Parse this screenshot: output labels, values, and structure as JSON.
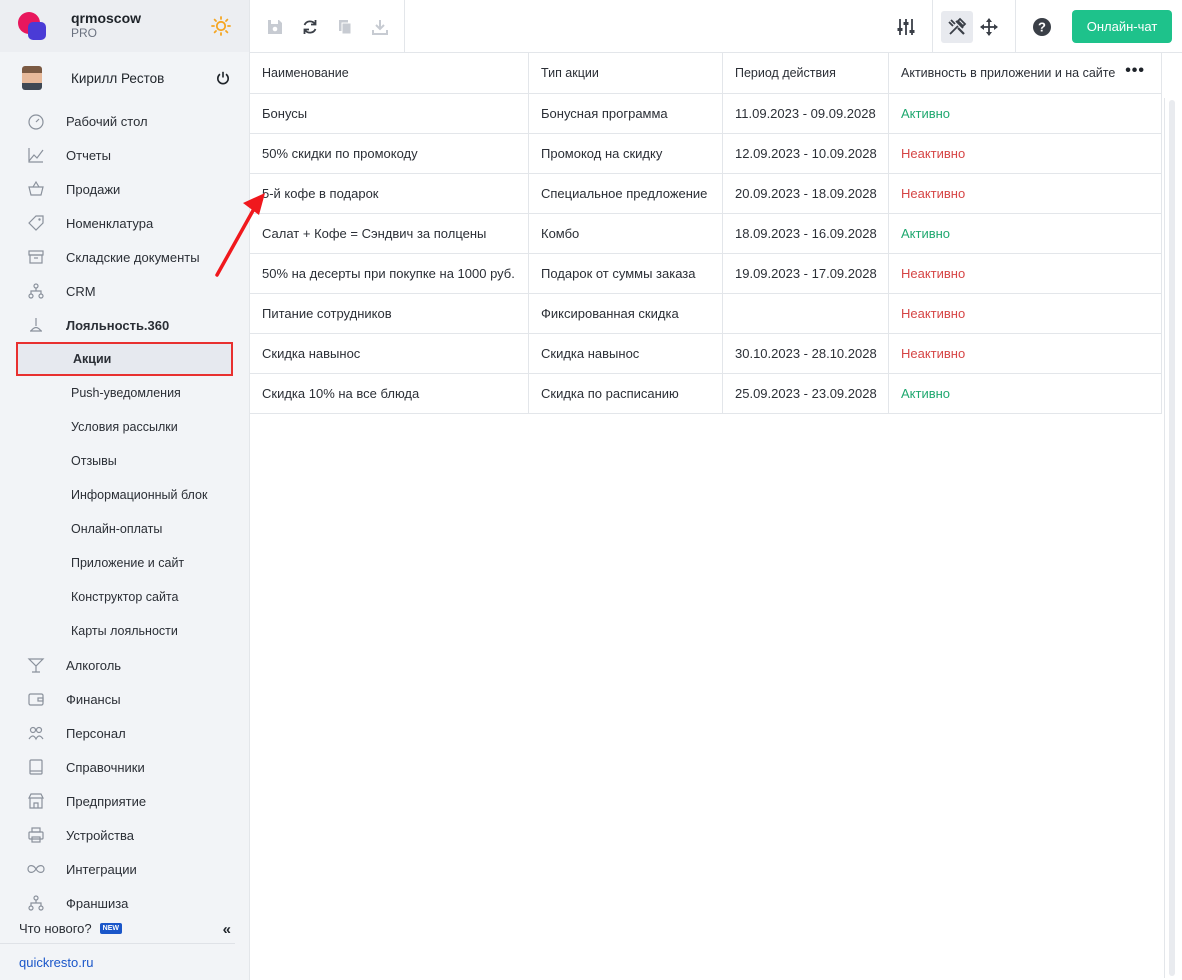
{
  "brand": {
    "name": "qrmoscow",
    "plan": "PRO"
  },
  "user": {
    "name": "Кирилл Рестов"
  },
  "nav": {
    "items": [
      {
        "label": "Рабочий стол",
        "icon": "dashboard-icon"
      },
      {
        "label": "Отчеты",
        "icon": "chart-icon"
      },
      {
        "label": "Продажи",
        "icon": "basket-icon"
      },
      {
        "label": "Номенклатура",
        "icon": "tag-icon"
      },
      {
        "label": "Складские документы",
        "icon": "archive-icon"
      },
      {
        "label": "CRM",
        "icon": "hierarchy-icon"
      },
      {
        "label": "Лояльность.360",
        "icon": "loyalty-icon"
      }
    ],
    "sub": [
      {
        "label": "Акции"
      },
      {
        "label": "Push-уведомления"
      },
      {
        "label": "Условия рассылки"
      },
      {
        "label": "Отзывы"
      },
      {
        "label": "Информационный блок"
      },
      {
        "label": "Онлайн-оплаты"
      },
      {
        "label": "Приложение и сайт"
      },
      {
        "label": "Конструктор сайта"
      },
      {
        "label": "Карты лояльности"
      }
    ],
    "items2": [
      {
        "label": "Алкоголь",
        "icon": "cocktail-icon"
      },
      {
        "label": "Финансы",
        "icon": "wallet-icon"
      },
      {
        "label": "Персонал",
        "icon": "people-icon"
      },
      {
        "label": "Справочники",
        "icon": "book-icon"
      },
      {
        "label": "Предприятие",
        "icon": "store-icon"
      },
      {
        "label": "Устройства",
        "icon": "printer-icon"
      },
      {
        "label": "Интеграции",
        "icon": "infinity-icon"
      },
      {
        "label": "Франшиза",
        "icon": "hierarchy-icon"
      }
    ]
  },
  "footer": {
    "whatsnew": "Что нового?",
    "badge": "NEW",
    "site": "quickresto.ru"
  },
  "toolbar": {
    "chat_label": "Онлайн-чат"
  },
  "table": {
    "headers": [
      "Наименование",
      "Тип акции",
      "Период действия",
      "Активность в приложении и на сайте"
    ],
    "rows": [
      {
        "name": "Бонусы",
        "type": "Бонусная программа",
        "period": "11.09.2023 - 09.09.2028",
        "status": "Активно"
      },
      {
        "name": "50% скидки по промокоду",
        "type": "Промокод на скидку",
        "period": "12.09.2023 - 10.09.2028",
        "status": "Неактивно"
      },
      {
        "name": "5-й кофе в подарок",
        "type": "Специальное предложение",
        "period": "20.09.2023 - 18.09.2028",
        "status": "Неактивно"
      },
      {
        "name": "Салат + Кофе = Сэндвич за полцены",
        "type": "Комбо",
        "period": "18.09.2023 - 16.09.2028",
        "status": "Активно"
      },
      {
        "name": "50% на десерты при покупке на 1000 руб.",
        "type": "Подарок от суммы заказа",
        "period": "19.09.2023 - 17.09.2028",
        "status": "Неактивно"
      },
      {
        "name": "Питание сотрудников",
        "type": "Фиксированная скидка",
        "period": "",
        "status": "Неактивно"
      },
      {
        "name": "Скидка навынос",
        "type": "Скидка навынос",
        "period": "30.10.2023 - 28.10.2028",
        "status": "Неактивно"
      },
      {
        "name": "Скидка 10% на все блюда",
        "type": "Скидка по расписанию",
        "period": "25.09.2023 - 23.09.2028",
        "status": "Активно"
      }
    ]
  },
  "colors": {
    "active": "#1fa86f",
    "inactive": "#d64545",
    "accent": "#1ec28b",
    "highlight": "#e8302f"
  }
}
